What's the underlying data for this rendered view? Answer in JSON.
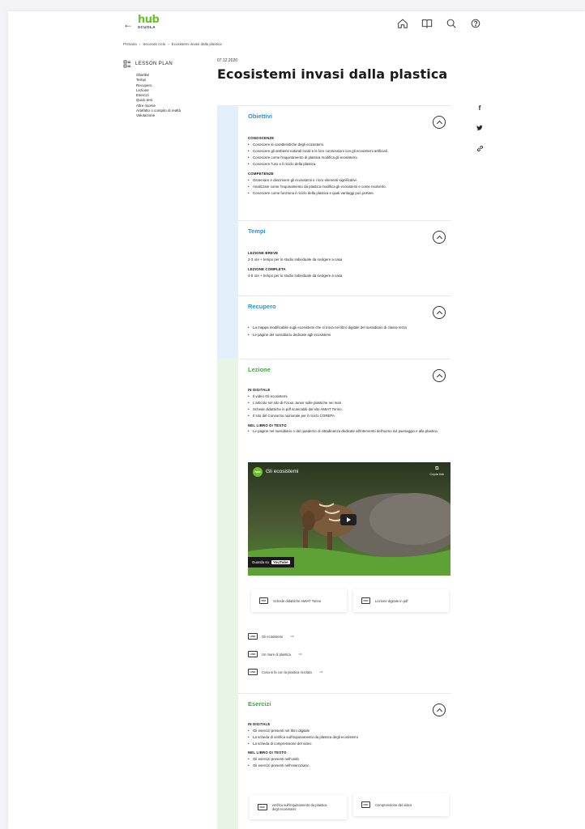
{
  "header": {
    "back": "←",
    "logo": {
      "hub": "hub",
      "scuola": "SCUOLA",
      "color": "#6bbf2a"
    },
    "icons": [
      "home-icon",
      "book-icon",
      "search-icon",
      "help-icon"
    ]
  },
  "breadcrumb": [
    "Primaria",
    "›",
    "Secondo ciclo",
    "›",
    "Ecosistemi invasi dalla plastica"
  ],
  "sidebar": {
    "heading": "LESSON PLAN",
    "items": [
      "Obiettivi",
      "Tempi",
      "Recupero",
      "Lezione",
      "Esercizi",
      "Quick test",
      "Altre risorse",
      "Artefatto o compito di realtà",
      "Valutazione"
    ]
  },
  "date": "07.12.2020",
  "title": "Ecosistemi invasi dalla plastica",
  "social": {
    "facebook": "f",
    "twitter": "🐦",
    "link": "🔗"
  },
  "colors": {
    "blue_stripe": "#e3effa",
    "green_stripe": "#e6f5e6",
    "blue_title": "#2a8fd6",
    "green_title": "#3eaa3e"
  },
  "sections": {
    "obiettivi": {
      "title": "Obiettivi",
      "h1": "CONOSCENZE",
      "k": [
        "Conoscere le caratteristiche degli ecosistemi.",
        "Conoscere gli ambienti naturali locali e le loro connessioni con gli ecosistemi artificiali.",
        "Conoscere come l'inquinamento di plastica modifica gli ecosistemi.",
        "Conoscere l'uso e il riciclo della plastica."
      ],
      "h2": "COMPETENZE",
      "c": [
        "Osservare e descrivere gli ecosistemi e i loro elementi significativi.",
        "Analizzare come l'inquinamento da plastica modifica gli ecosistemi e come risolverlo.",
        "Conoscere come funziona il riciclo della plastica e quali vantaggi può portare."
      ]
    },
    "tempi": {
      "title": "Tempi",
      "h1": "LEZIONE BREVE",
      "t1": "2-3 ore + tempo per lo studio individuale da svolgere a casa",
      "h2": "LEZIONE COMPLETA",
      "t2": "4-5 ore + tempo per lo studio individuale da svolgere a casa"
    },
    "recupero": {
      "title": "Recupero",
      "items": [
        "La mappa modificabile sugli ecosistemi che si trova nel libro digitale del sussidiario di classe terza",
        "Le pagine del sussidiario dedicate agli ecosistemi"
      ]
    },
    "lezione": {
      "title": "Lezione",
      "h1": "IN DIGITALE",
      "d": [
        "Il video Gli ecosistemi",
        "L'articolo nel sito di Focus Junior sulle plastiche nei mari",
        "Schede didattiche in pdf scaricabili dal sito AMIAT Torino.",
        "Il sito del Consorzio nazionale per il riciclo COREPA"
      ],
      "h2": "NEL LIBRO DI TESTO",
      "l": [
        "Le pagine nel sussidiario o del quaderno di cittadinanza dedicate all'intervento dell'uomo sul paesaggio e alla plastica"
      ],
      "video": {
        "title": "Gli ecosistemi",
        "copy": "Copia link",
        "watch": "Guarda su",
        "yt": "YouTube",
        "chan": "hub"
      },
      "cards": [
        {
          "badge": "PDF",
          "label": "Schede didattiche AMIAT Torino"
        },
        {
          "badge": "PDF",
          "label": "Lezione digitale in pdf"
        }
      ],
      "links": [
        {
          "badge": "LINK",
          "label": "Gli ecosistemi"
        },
        {
          "badge": "LINK",
          "label": "Un mare di plastica"
        },
        {
          "badge": "LINK",
          "label": "Cosa si fa con la plastica riciclata"
        }
      ]
    },
    "esercizi": {
      "title": "Esercizi",
      "h1": "IN DIGITALE",
      "d": [
        "Gli esercizi presenti nel libro digitale",
        "La scheda di verifica sull'inquinamento da plastica degli ecosistemi",
        "La scheda di comprensione del video"
      ],
      "h2": "NEL LIBRO DI TESTO",
      "l": [
        "Gli esercizi presenti nell'unità",
        "Gli esercizi presenti nell'eserciziario"
      ],
      "cards": [
        {
          "badge": "DOC",
          "label": "verifica sull'inquinamento da plastica degli ecosistemi"
        },
        {
          "badge": "PDF",
          "label": "Comprensione del video"
        }
      ]
    }
  }
}
